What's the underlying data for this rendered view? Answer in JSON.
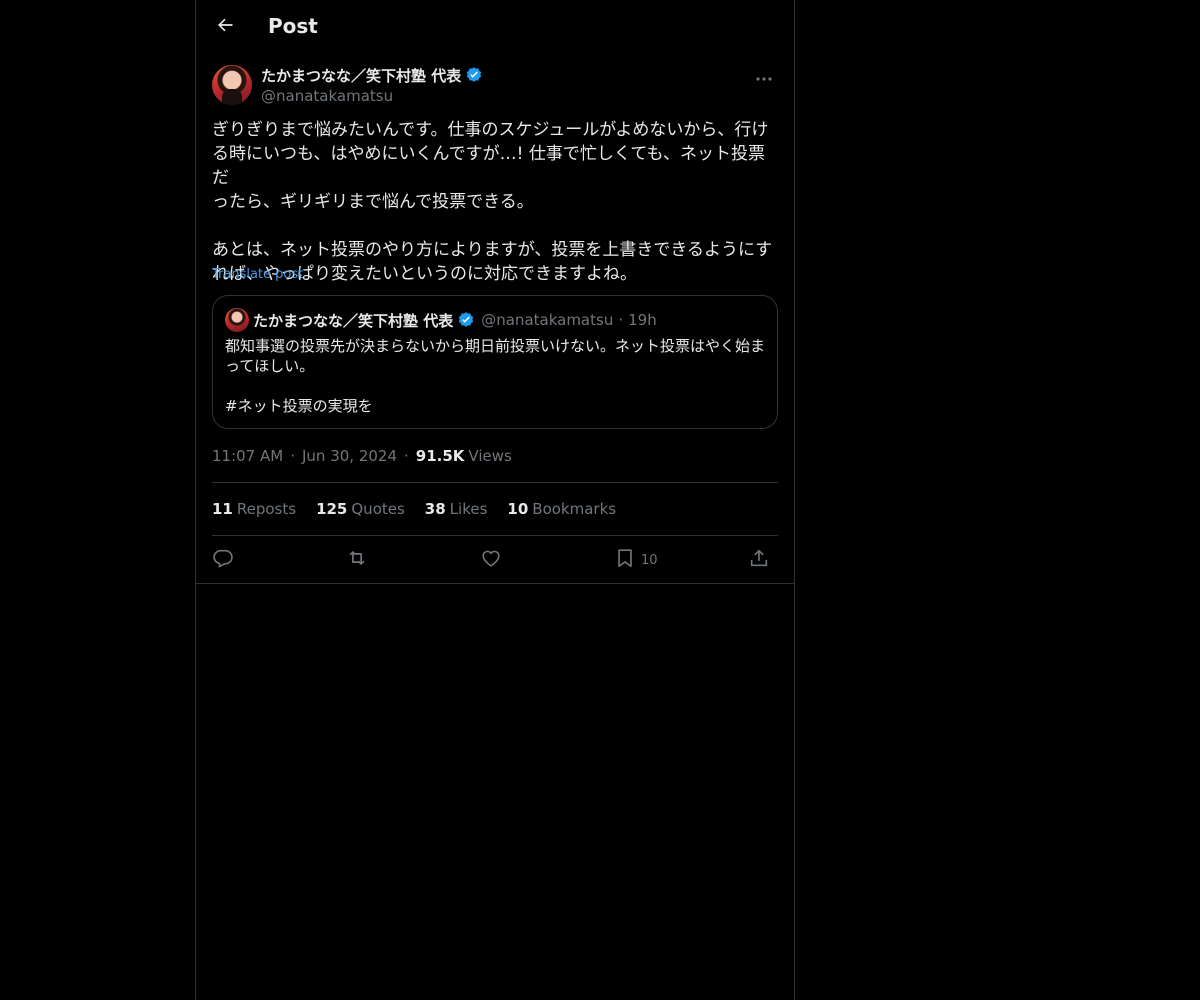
{
  "header": {
    "title": "Post"
  },
  "post": {
    "display_name": "たかまつなな／笑下村塾 代表",
    "handle": "@nanatakamatsu",
    "text": "ぎりぎりまで悩みたいんです。仕事のスケジュールがよめないから、行け\nる時にいつも、はやめにいくんですが…! 仕事で忙しくても、ネット投票だ\nったら、ギリギリまで悩んで投票できる。\n\nあとは、ネット投票のやり方によりますが、投票を上書きできるようにす\nれば、やっぱり変えたいというのに対応できますよね。",
    "translate_label": "Translate post",
    "time": "11:07 AM",
    "date": "Jun 30, 2024",
    "views_count": "91.5K",
    "views_label": "Views"
  },
  "quote": {
    "display_name": "たかまつなな／笑下村塾 代表",
    "handle": "@nanatakamatsu",
    "dot": "·",
    "time": "19h",
    "text": "都知事選の投票先が決まらないから期日前投票いけない。ネット投票はやく始ま\nってほしい。\n\n#ネット投票の実現を"
  },
  "meta": {
    "sep": "·"
  },
  "stats": {
    "reposts_count": "11",
    "reposts_label": "Reposts",
    "quotes_count": "125",
    "quotes_label": "Quotes",
    "likes_count": "38",
    "likes_label": "Likes",
    "bookmarks_count": "10",
    "bookmarks_label": "Bookmarks"
  },
  "actions": {
    "bookmark_count": "10"
  },
  "icons": {
    "back": "arrow-left-icon",
    "verified": "verified-badge-icon",
    "more": "more-horizontal-icon",
    "reply": "reply-icon",
    "repost": "repost-icon",
    "like": "heart-icon",
    "bookmark": "bookmark-icon",
    "share": "share-icon"
  },
  "colors": {
    "background": "#000000",
    "text": "#e7e9ea",
    "muted": "#71767b",
    "link": "#4a9be8",
    "verified": "#1d9bf0",
    "border": "#2f3336"
  }
}
